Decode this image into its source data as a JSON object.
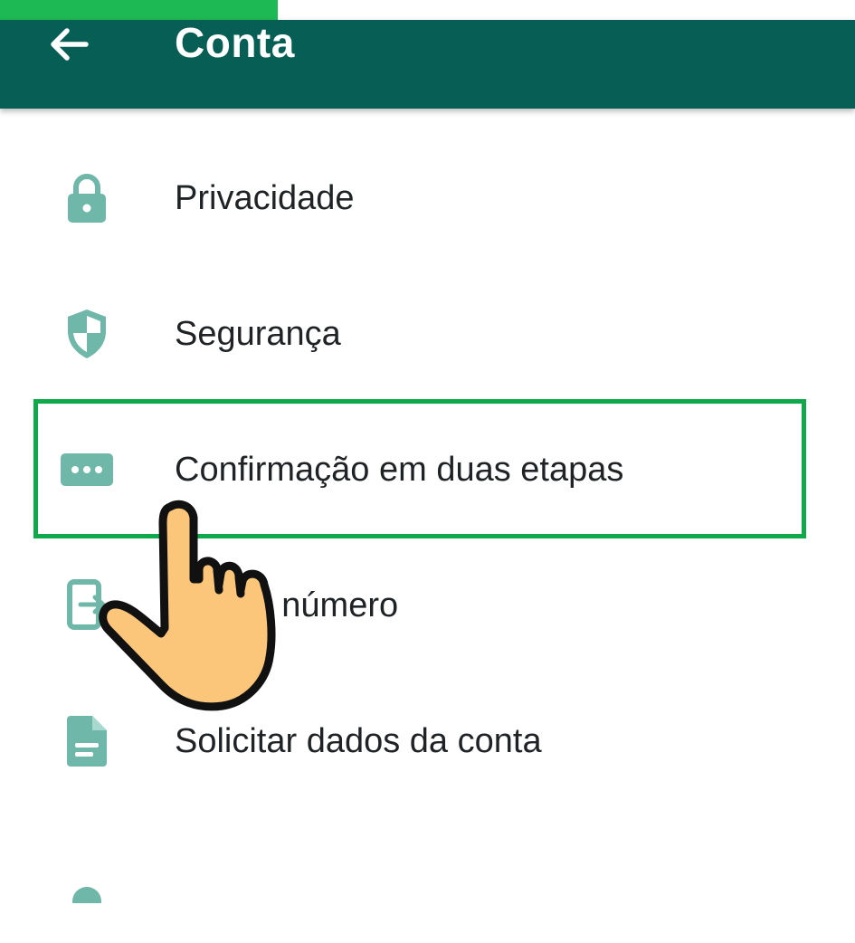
{
  "status": {
    "progress": 0.325,
    "progress_color": "#1db954"
  },
  "appbar": {
    "back_icon": "arrow-left-icon",
    "title": "Conta",
    "background": "#075e54"
  },
  "menu": {
    "accent_icon_color": "#6fb8a9",
    "items": [
      {
        "icon": "lock-icon",
        "label": "Privacidade"
      },
      {
        "icon": "shield-icon",
        "label": "Segurança"
      },
      {
        "icon": "dots-icon",
        "label": "Confirmação em duas etapas"
      },
      {
        "icon": "change-number-icon",
        "label": "Mudar número"
      },
      {
        "icon": "document-icon",
        "label": "Solicitar dados da conta"
      }
    ]
  },
  "overlay": {
    "highlight_color": "#0fa84a",
    "pointer_icon": "pointing-hand-icon"
  }
}
